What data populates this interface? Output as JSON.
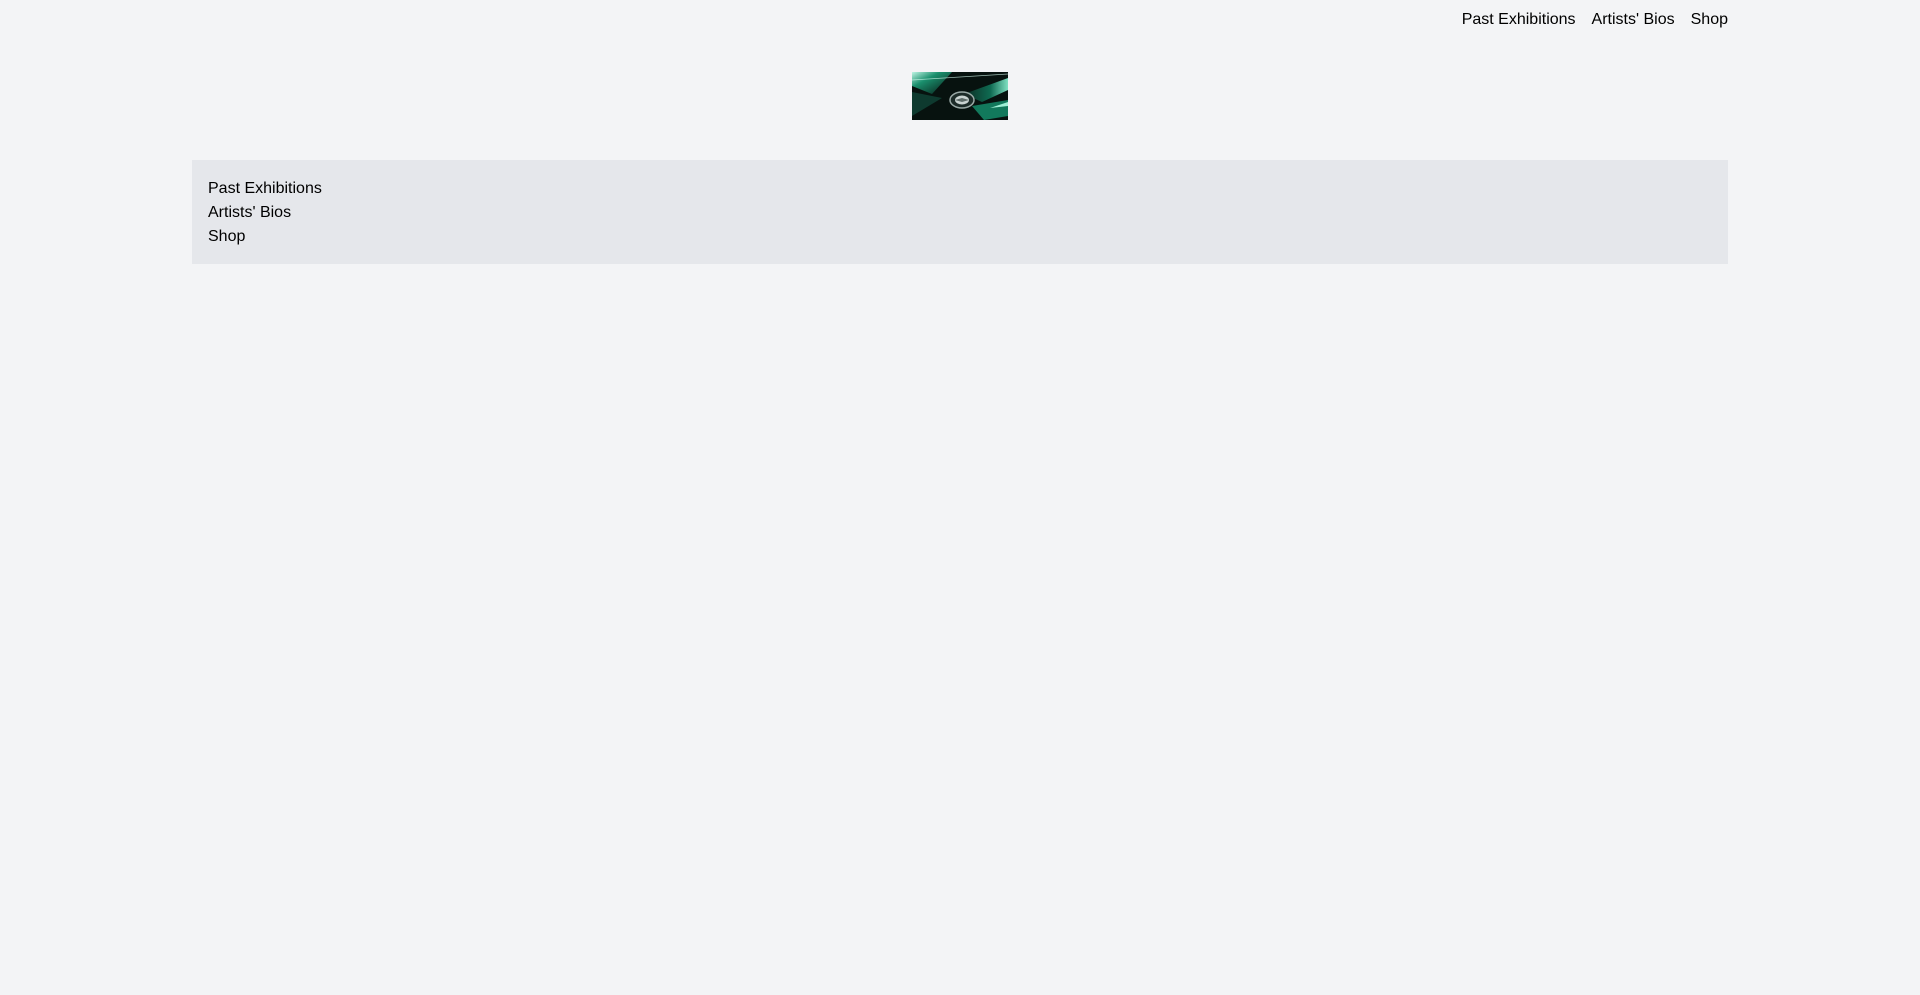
{
  "header": {
    "nav": [
      {
        "label": "Past Exhibitions"
      },
      {
        "label": "Artists' Bios"
      },
      {
        "label": "Shop"
      }
    ]
  },
  "logo": {
    "image": "green-car-hood-emblem-photo",
    "colors": {
      "dark": "#0b1a16",
      "green": "#0f6b52",
      "highlight": "#7fe0c2"
    }
  },
  "menu": {
    "items": [
      {
        "label": "Past Exhibitions"
      },
      {
        "label": "Artists' Bios"
      },
      {
        "label": "Shop"
      }
    ]
  },
  "theme": {
    "background": "#f3f4f6",
    "menu_background": "#e5e7eb",
    "text": "#000000"
  }
}
